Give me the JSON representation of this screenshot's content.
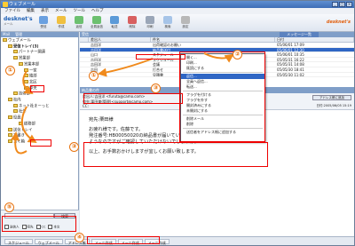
{
  "app": {
    "title": "ウェブメール",
    "window_buttons": [
      "_",
      "□",
      "×"
    ]
  },
  "menu": [
    "ファイル",
    "編集",
    "表示",
    "メール",
    "ツール",
    "ヘルプ"
  ],
  "logo": {
    "name": "desknet's",
    "sub": "メール"
  },
  "toolbar": [
    "受信",
    "作成",
    "返信",
    "全員返信",
    "転送",
    "削除",
    "印刷",
    "検索",
    "設定"
  ],
  "brand": "desknet's",
  "left": {
    "header": [
      "Mail",
      "管理"
    ],
    "tree": [
      {
        "label": "ウェブメール",
        "level": 0
      },
      {
        "label": "受信トレイ(3)",
        "level": 1,
        "bold": true
      },
      {
        "label": "パートナー関連",
        "level": 2
      },
      {
        "label": "営業部",
        "level": 2
      },
      {
        "label": "営業本部",
        "level": 3
      },
      {
        "label": "一家",
        "level": 4
      },
      {
        "label": "綾部",
        "level": 4
      },
      {
        "label": "北区",
        "level": 4
      },
      {
        "label": "中央",
        "level": 4
      },
      {
        "label": "技術部",
        "level": 2
      },
      {
        "label": "社内",
        "level": 1
      },
      {
        "label": "ネット社まーっと",
        "level": 2
      },
      {
        "label": "社外",
        "level": 2
      },
      {
        "label": "役員",
        "level": 1
      },
      {
        "label": "総務部",
        "level": 3
      },
      {
        "label": "送信トレイ",
        "level": 1
      },
      {
        "label": "下書き",
        "level": 1
      },
      {
        "label": "ゴミ箱",
        "level": 1
      }
    ],
    "search_button": "検索",
    "options": [
      "送信人",
      "宛先",
      "CC",
      "本文"
    ]
  },
  "right": {
    "header": "受信",
    "header_tab": "メッセージ一覧",
    "columns": [
      "",
      "差出人",
      "件名",
      "日付"
    ],
    "rows": [
      {
        "from": "吉田洋",
        "subject": "出荷確認のお願い",
        "date": "05/06/01 17:09",
        "sel": false
      },
      {
        "from": "吉田洋",
        "subject": "納品書送付",
        "date": "05/06/01 12:30",
        "sel": true
      },
      {
        "from": "山口",
        "subject": "スケジュール",
        "date": "05/06/01 10:35",
        "sel": false
      },
      {
        "from": "吉田洋",
        "subject": "スケジュール",
        "date": "05/05/31 16:22",
        "sel": false
      },
      {
        "from": "吉田洋",
        "subject": "会議",
        "date": "05/05/31 14:08",
        "sel": false
      },
      {
        "from": "吉田",
        "subject": "打合せ",
        "date": "05/05/30 18:41",
        "sel": false
      },
      {
        "from": "吉田",
        "subject": "見積書",
        "date": "05/05/30 11:02",
        "sel": false
      }
    ],
    "preview_header": "納品書の件",
    "from_line": "差出人:吉田洋 <furuta@camo.com>",
    "to_line": "宛先:栗田美(管理)<support@camo.com>",
    "cc_line": "CC:",
    "header_button": "アドレス帳に追加",
    "date": "日付:2005/06/05 15:19",
    "body": [
      "宛先:栗田様",
      "お疲れ様です。佐藤です。",
      "発注番号:HB00050020の納品書が届いていない",
      "ようなのですがご確認していただけないでしょうか。",
      "以上、お手数おかけしますが宜しくお願い致します。"
    ]
  },
  "context_menu": [
    "開く...",
    "印刷...",
    "既読にする",
    "返信...",
    "全員へ返信...",
    "転送...",
    "フラグを付ける",
    "フラグを外す",
    "開封済みにする",
    "未開封にする",
    "削除メール",
    "削除",
    "送信者をアドレス帳に追加する"
  ],
  "context_highlight_index": 3,
  "status": [
    "スケジュール",
    "ウェブメール",
    "アドレス帳",
    "メール作成",
    "メール作成",
    "メール作成"
  ],
  "callouts": [
    "①",
    "①",
    "②",
    "③",
    "③",
    "④",
    "⑤"
  ]
}
